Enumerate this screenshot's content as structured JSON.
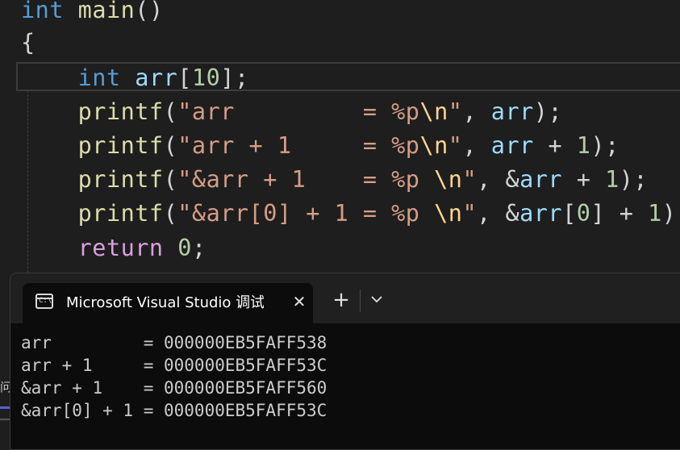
{
  "editor": {
    "line1": {
      "kw": "int",
      "fn": "main",
      "punct": "()"
    },
    "line2": {
      "brace": "{"
    },
    "line3": {
      "kw": "int",
      "var": "arr",
      "idx": "10",
      "br_open": "[",
      "br_close": "]",
      "semi": ";"
    },
    "printf": [
      {
        "fn": "printf",
        "open": "(",
        "str_pre": "\"arr         = %p",
        "esc": "\\n",
        "str_post": "\"",
        "args": ", arr);"
      },
      {
        "fn": "printf",
        "open": "(",
        "str_pre": "\"arr + 1     = %p",
        "esc": "\\n",
        "str_post": "\"",
        "args": ", arr + 1);"
      },
      {
        "fn": "printf",
        "open": "(",
        "str_pre": "\"&arr + 1    = %p ",
        "esc": "\\n",
        "str_post": "\"",
        "args": ", &arr + 1);"
      },
      {
        "fn": "printf",
        "open": "(",
        "str_pre": "\"&arr[0] + 1 = %p ",
        "esc": "\\n",
        "str_post": "\"",
        "args": ", &arr[0] + 1);"
      }
    ],
    "return_line": {
      "kw": "return",
      "num": "0",
      "semi": ";"
    }
  },
  "terminal": {
    "tab_icon_text": "C:\\",
    "tab_title": "Microsoft Visual Studio 调试控制台",
    "close_glyph": "✕",
    "new_tab_glyph": "+",
    "output": [
      "arr         = 000000EB5FAFF538",
      "arr + 1     = 000000EB5FAFF53C",
      "&arr + 1    = 000000EB5FAFF560",
      "&arr[0] + 1 = 000000EB5FAFF53C"
    ]
  },
  "side_glyph": "问题"
}
